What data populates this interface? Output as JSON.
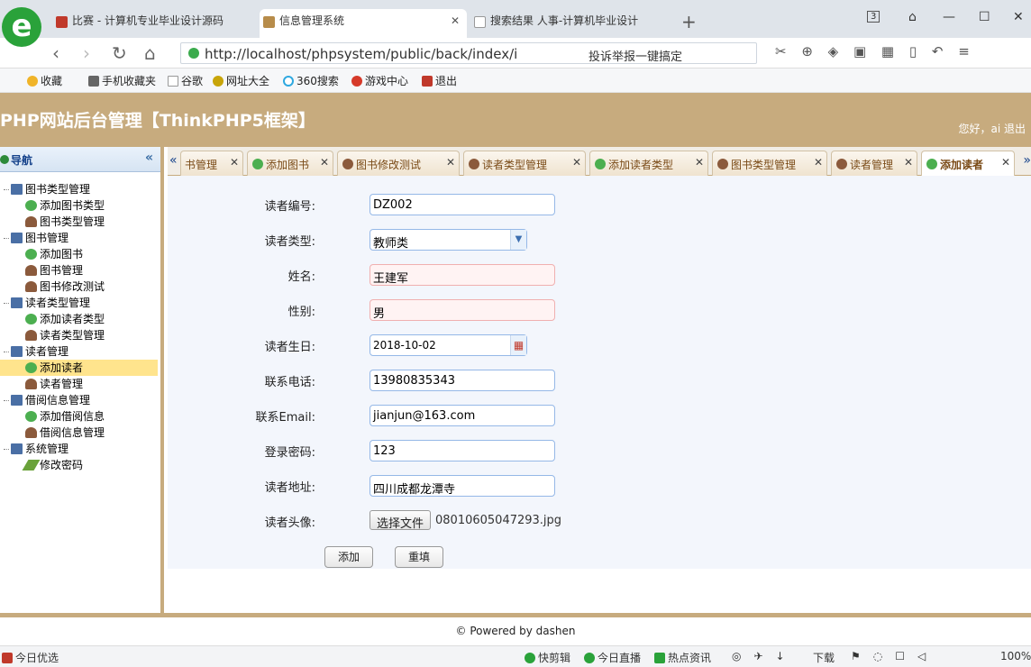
{
  "browser": {
    "tabs": [
      {
        "label": "比赛 - 计算机专业毕业设计源码",
        "color": "#c0392b"
      },
      {
        "label": "信息管理系统",
        "color": "#b78c4a"
      },
      {
        "label": "搜索结果 人事-计算机毕业设计",
        "color": "#888888"
      }
    ],
    "url": "http://localhost/phpsystem/public/back/index/i",
    "search_hint": "投诉举报一键搞定",
    "bookmarks": [
      "收藏",
      "手机收藏夹",
      "谷歌",
      "网址大全",
      "360搜索",
      "游戏中心",
      "退出"
    ],
    "tab_count": "3"
  },
  "header": {
    "title": "PHP网站后台管理【ThinkPHP5框架】",
    "user": "您好，ai 退出"
  },
  "sidebar": {
    "title": "导航",
    "collapse": "«",
    "tree": [
      {
        "label": "图书类型管理",
        "level": 0,
        "icon": "group"
      },
      {
        "label": "添加图书类型",
        "level": 1,
        "icon": "plus"
      },
      {
        "label": "图书类型管理",
        "level": 1,
        "icon": "person"
      },
      {
        "label": "图书管理",
        "level": 0,
        "icon": "group"
      },
      {
        "label": "添加图书",
        "level": 1,
        "icon": "plus"
      },
      {
        "label": "图书管理",
        "level": 1,
        "icon": "person"
      },
      {
        "label": "图书修改测试",
        "level": 1,
        "icon": "person"
      },
      {
        "label": "读者类型管理",
        "level": 0,
        "icon": "group"
      },
      {
        "label": "添加读者类型",
        "level": 1,
        "icon": "plus"
      },
      {
        "label": "读者类型管理",
        "level": 1,
        "icon": "person"
      },
      {
        "label": "读者管理",
        "level": 0,
        "icon": "group"
      },
      {
        "label": "添加读者",
        "level": 1,
        "icon": "plus",
        "selected": true
      },
      {
        "label": "读者管理",
        "level": 1,
        "icon": "person"
      },
      {
        "label": "借阅信息管理",
        "level": 0,
        "icon": "group"
      },
      {
        "label": "添加借阅信息",
        "level": 1,
        "icon": "plus"
      },
      {
        "label": "借阅信息管理",
        "level": 1,
        "icon": "person"
      },
      {
        "label": "系统管理",
        "level": 0,
        "icon": "group"
      },
      {
        "label": "修改密码",
        "level": 1,
        "icon": "pencil"
      }
    ]
  },
  "content_tabs": [
    {
      "label": "书管理",
      "icon": "none"
    },
    {
      "label": "添加图书",
      "icon": "plus"
    },
    {
      "label": "图书修改测试",
      "icon": "person"
    },
    {
      "label": "读者类型管理",
      "icon": "person"
    },
    {
      "label": "添加读者类型",
      "icon": "plus"
    },
    {
      "label": "图书类型管理",
      "icon": "person"
    },
    {
      "label": "读者管理",
      "icon": "person"
    },
    {
      "label": "添加读者",
      "icon": "plus",
      "active": true
    }
  ],
  "form": {
    "reader_no": {
      "label": "读者编号:",
      "value": "DZ002"
    },
    "reader_type": {
      "label": "读者类型:",
      "value": "教师类"
    },
    "name": {
      "label": "姓名:",
      "value": "王建军"
    },
    "gender": {
      "label": "性别:",
      "value": "男"
    },
    "birthday": {
      "label": "读者生日:",
      "value": "2018-10-02"
    },
    "phone": {
      "label": "联系电话:",
      "value": "13980835343"
    },
    "email": {
      "label": "联系Email:",
      "value": "jianjun@163.com"
    },
    "password": {
      "label": "登录密码:",
      "value": "123"
    },
    "address": {
      "label": "读者地址:",
      "value": "四川成都龙潭寺"
    },
    "avatar": {
      "label": "读者头像:",
      "button": "选择文件",
      "filename": "08010605047293.jpg"
    },
    "add_button": "添加",
    "reset_button": "重填"
  },
  "footer": "© Powered by dashen",
  "statusbar": [
    "今日优选",
    "快剪辑",
    "今日直播",
    "热点资讯",
    "下载",
    "100%"
  ]
}
